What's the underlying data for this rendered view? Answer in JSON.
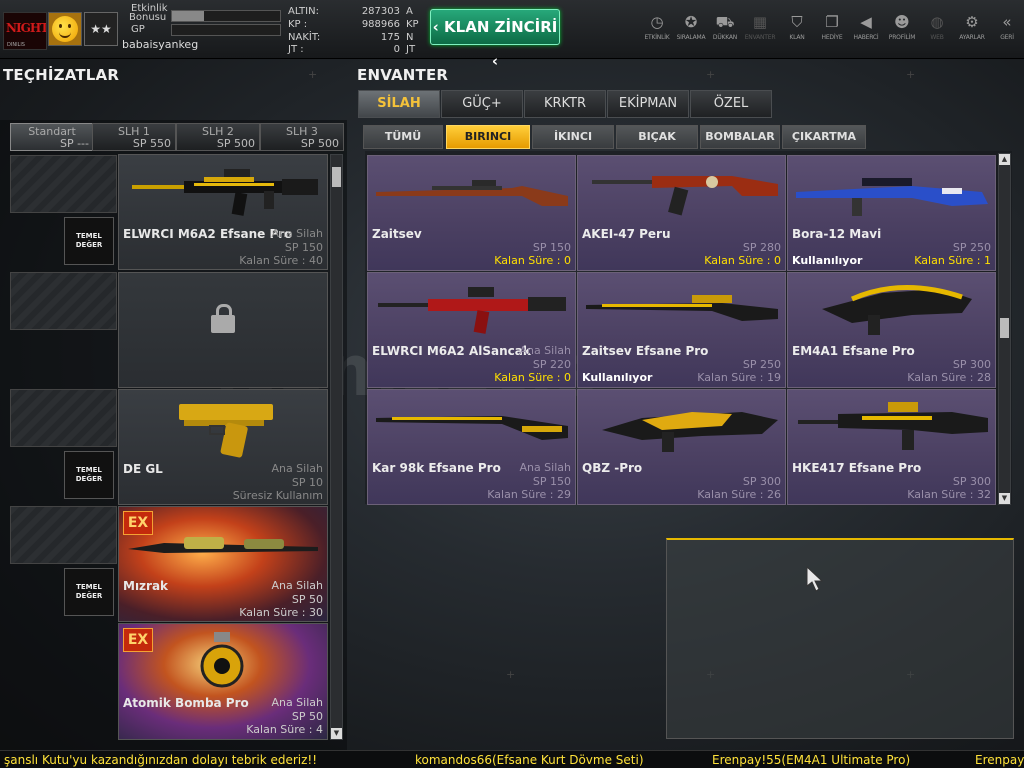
{
  "player": {
    "clan_logo_text": "NIGHT",
    "clan_logo_sub": "DINILIS",
    "rank_icon": "two-stars-icon",
    "etkinlik_label_1": "Etkinlik",
    "etkinlik_label_2": "Bonusu",
    "gp_label": "GP",
    "etkinlik_progress": 0.3,
    "gp_progress": 0.0,
    "username": "babaisyankeg"
  },
  "currency": {
    "altin_label": "ALTIN:",
    "altin_value": "287303",
    "altin_unit": "A",
    "kp_label": "KP :",
    "kp_value": "988966",
    "kp_unit": "KP",
    "nakit_label": "NAKİT:",
    "nakit_value": "175",
    "nakit_unit": "N",
    "jt_label": "JT :",
    "jt_value": "0",
    "jt_unit": "JT"
  },
  "klan_button": "KLAN ZİNCİRİ",
  "topnav": [
    {
      "label": "ETKİNLİK",
      "icon": "clock-icon"
    },
    {
      "label": "SIRALAMA",
      "icon": "medal-icon"
    },
    {
      "label": "DÜKKAN",
      "icon": "cart-icon"
    },
    {
      "label": "ENVANTER",
      "icon": "inventory-icon"
    },
    {
      "label": "KLAN",
      "icon": "shield-icon"
    },
    {
      "label": "HEDİYE",
      "icon": "gift-icon"
    },
    {
      "label": "HABERCİ",
      "icon": "megaphone-icon"
    },
    {
      "label": "PROFİLİM",
      "icon": "profile-icon"
    },
    {
      "label": "WEB",
      "icon": "globe-icon"
    },
    {
      "label": "AYARLAR",
      "icon": "gear-icon"
    },
    {
      "label": "GERİ",
      "icon": "back-icon"
    }
  ],
  "left": {
    "title": "TEÇHİZATLAR",
    "slots": [
      {
        "title": "Standart",
        "sp": "SP ---"
      },
      {
        "title": "SLH 1",
        "sp": "SP 550"
      },
      {
        "title": "SLH 2",
        "sp": "SP 500"
      },
      {
        "title": "SLH 3",
        "sp": "SP 500"
      }
    ],
    "temel_label_1": "TEMEL",
    "temel_label_2": "DEĞER",
    "items": [
      {
        "name": "ELWRCI M6A2 Efsane Pro",
        "category": "Ana Silah",
        "sp": "SP 150",
        "kalan": "Kalan Süre : 40",
        "ex": ""
      },
      {
        "name": "",
        "category": "",
        "sp": "",
        "kalan": "",
        "ex": "",
        "locked": true
      },
      {
        "name": "DE GL",
        "category": "Ana Silah",
        "sp": "SP 10",
        "kalan": "Süresiz Kullanım",
        "ex": ""
      },
      {
        "name": "Mızrak",
        "category": "Ana Silah",
        "sp": "SP 50",
        "kalan": "Kalan Süre : 30",
        "ex": "EX"
      },
      {
        "name": "Atomik Bomba Pro",
        "category": "Ana Silah",
        "sp": "SP 50",
        "kalan": "Kalan Süre : 4",
        "ex": "EX"
      }
    ]
  },
  "right": {
    "title": "ENVANTER",
    "main_tabs": [
      "SİLAH",
      "GÜÇ+",
      "KRKTR",
      "EKİPMAN",
      "ÖZEL"
    ],
    "sub_tabs": [
      "TÜMÜ",
      "BIRINCI",
      "İKINCI",
      "BIÇAK",
      "BOMBALAR",
      "ÇIKARTMA"
    ],
    "items": [
      {
        "name": "Zaitsev",
        "category": "",
        "sp": "SP 150",
        "kalan": "Kalan Süre : 0",
        "status": ""
      },
      {
        "name": "AKEI-47 Peru",
        "category": "",
        "sp": "SP 280",
        "kalan": "Kalan Süre : 0",
        "status": ""
      },
      {
        "name": "Bora-12 Mavi",
        "category": "",
        "sp": "SP 250",
        "kalan": "Kalan Süre : 1",
        "status": "Kullanılıyor"
      },
      {
        "name": "ELWRCI M6A2 AlSancak",
        "category": "Ana Silah",
        "sp": "SP 220",
        "kalan": "Kalan Süre : 0",
        "status": ""
      },
      {
        "name": "Zaitsev Efsane Pro",
        "category": "",
        "sp": "SP 250",
        "kalan": "Kalan Süre : 19",
        "status": "Kullanılıyor"
      },
      {
        "name": "EM4A1 Efsane Pro",
        "category": "",
        "sp": "SP 300",
        "kalan": "Kalan Süre : 28",
        "status": ""
      },
      {
        "name": "Kar 98k Efsane Pro",
        "category": "Ana Silah",
        "sp": "SP 150",
        "kalan": "Kalan Süre : 29",
        "status": ""
      },
      {
        "name": "QBZ -Pro",
        "category": "",
        "sp": "SP 300",
        "kalan": "Kalan Süre : 26",
        "status": ""
      },
      {
        "name": "HKE417 Efsane Pro",
        "category": "",
        "sp": "SP 300",
        "kalan": "Kalan Süre : 32",
        "status": ""
      }
    ]
  },
  "watermark": "itemsatis",
  "ticker": [
    "şanslı Kutu'yu kazandığınızdan dolayı tebrik ederiz!!",
    "komandos66(Efsane Kurt Dövme Seti)",
    "Erenpay!55(EM4A1 Ultimate Pro)",
    "Erenpay"
  ],
  "colors": {
    "accent": "#f4c23a",
    "klan_green": "#27a87a",
    "ticker_yellow": "#ffe23a",
    "card_purple": "#4b4062"
  }
}
